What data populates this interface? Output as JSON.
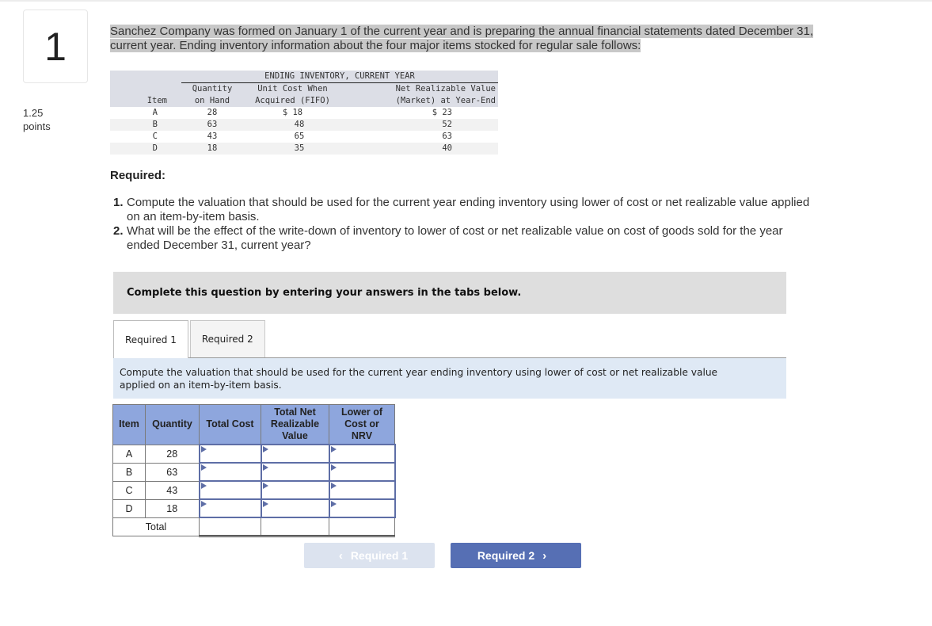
{
  "question": {
    "number": "1",
    "points_value": "1.25",
    "points_label": "points",
    "intro_line1": "Sanchez Company was formed on January 1 of the current year and is preparing the annual financial statements dated December 31,",
    "intro_line2": "current year. Ending inventory information about the four major items stocked for regular sale follows:"
  },
  "given_table": {
    "caption": "ENDING INVENTORY, CURRENT YEAR",
    "headers": {
      "item": "Item",
      "qty_line1": "Quantity",
      "qty_line2": "on Hand",
      "cost_line1": "Unit Cost When",
      "cost_line2": "Acquired (FIFO)",
      "nrv_line1": "Net Realizable Value",
      "nrv_line2": "(Market) at Year-End"
    },
    "rows": [
      {
        "item": "A",
        "qty": "28",
        "unit_cost": "$ 18",
        "nrv": "$ 23"
      },
      {
        "item": "B",
        "qty": "63",
        "unit_cost": "48",
        "nrv": "52"
      },
      {
        "item": "C",
        "qty": "43",
        "unit_cost": "65",
        "nrv": "63"
      },
      {
        "item": "D",
        "qty": "18",
        "unit_cost": "35",
        "nrv": "40"
      }
    ]
  },
  "required": {
    "title": "Required:",
    "items": [
      {
        "num": "1.",
        "line1": "Compute the valuation that should be used for the current year ending inventory using lower of cost or net realizable value applied",
        "line2": "on an item-by-item basis."
      },
      {
        "num": "2.",
        "line1": "What will be the effect of the write-down of inventory to lower of cost or net realizable value on cost of goods sold for the year",
        "line2": "ended December 31, current year?"
      }
    ]
  },
  "instruction": "Complete this question by entering your answers in the tabs below.",
  "tabs": [
    {
      "label": "Required 1",
      "active": true
    },
    {
      "label": "Required 2",
      "active": false
    }
  ],
  "task": {
    "line1": "Compute the valuation that should be used for the current year ending inventory using lower of cost or net realizable value",
    "line2": "applied on an item-by-item basis."
  },
  "answer_table": {
    "headers": {
      "item": "Item",
      "quantity": "Quantity",
      "total_cost": "Total Cost",
      "nrv_line1": "Total Net",
      "nrv_line2": "Realizable",
      "nrv_line3": "Value",
      "lc_line1": "Lower of",
      "lc_line2": "Cost or",
      "lc_line3": "NRV"
    },
    "rows": [
      {
        "item": "A",
        "quantity": "28",
        "total_cost": "",
        "total_nrv": "",
        "lower": ""
      },
      {
        "item": "B",
        "quantity": "63",
        "total_cost": "",
        "total_nrv": "",
        "lower": ""
      },
      {
        "item": "C",
        "quantity": "43",
        "total_cost": "",
        "total_nrv": "",
        "lower": ""
      },
      {
        "item": "D",
        "quantity": "18",
        "total_cost": "",
        "total_nrv": "",
        "lower": ""
      }
    ],
    "total_label": "Total",
    "totals": {
      "total_cost": "",
      "total_nrv": "",
      "lower": ""
    }
  },
  "navigation": {
    "prev_label": "Required 1",
    "prev_icon": "chevron-left-icon",
    "prev_enabled": false,
    "next_label": "Required 2",
    "next_icon": "chevron-right-icon",
    "next_enabled": true
  },
  "colors": {
    "header_blue": "#8ea6dd",
    "input_border": "#5e6ea6",
    "next_button": "#566fb4",
    "prev_button_disabled": "#dce3ef",
    "task_background": "#dfe9f5",
    "instruction_background": "#dedede",
    "highlight": "#c8c8c8"
  }
}
